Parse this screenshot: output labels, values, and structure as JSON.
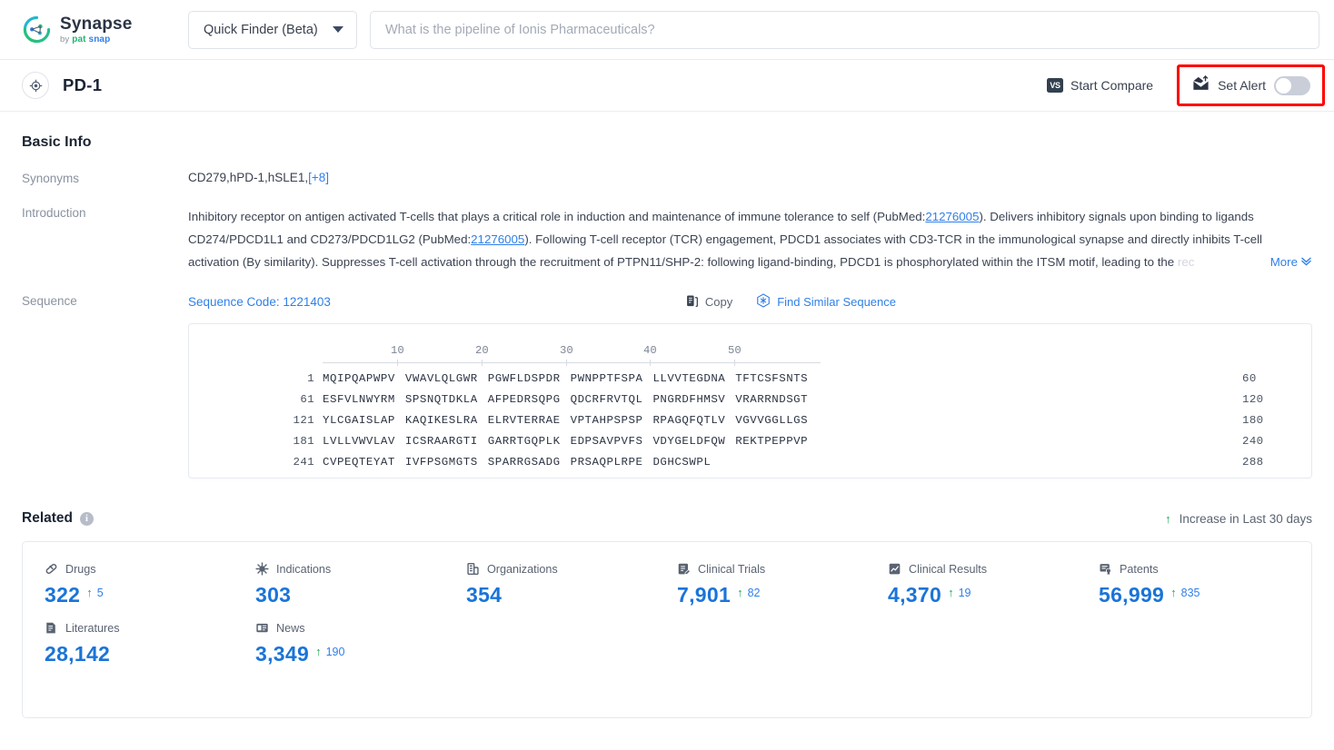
{
  "brand": {
    "name": "Synapse",
    "by": "by",
    "sub1": "pat",
    "sub2": "snap"
  },
  "topbar": {
    "finder_label": "Quick Finder (Beta)",
    "search_placeholder": "What is the pipeline of Ionis Pharmaceuticals?",
    "search_value": ""
  },
  "entity": {
    "name": "PD-1",
    "icon": "target-icon",
    "compare_label": "Start Compare",
    "compare_badge": "VS",
    "alert_label": "Set Alert",
    "alert_on": false,
    "highlight_color": "#ff0000"
  },
  "basic_info": {
    "title": "Basic Info",
    "synonyms_label": "Synonyms",
    "synonyms_value": "CD279,hPD-1,hSLE1,",
    "synonyms_more": "[+8]",
    "introduction_label": "Introduction",
    "introduction_parts": {
      "p1": "Inhibitory receptor on antigen activated T-cells that plays a critical role in induction and maintenance of immune tolerance to self (PubMed:",
      "pmid1": "21276005",
      "p2": "). Delivers inhibitory signals upon binding to ligands CD274/PDCD1L1 and CD273/PDCD1LG2 (PubMed:",
      "pmid2": "21276005",
      "p3": "). Following T-cell receptor (TCR) engagement, PDCD1 associates with CD3-TCR in the immunological synapse and directly inhibits T-cell activation (By similarity). Suppresses T-cell activation through the recruitment of PTPN11/SHP-2: following ligand-binding, PDCD1 is phosphorylated within the ITSM motif, leading to the ",
      "tail": "rec"
    },
    "more_label": "More",
    "more_chevron": "⌄"
  },
  "sequence": {
    "label": "Sequence",
    "code_label": "Sequence Code: 1221403",
    "copy_label": "Copy",
    "find_similar_label": "Find Similar Sequence",
    "ruler_ticks": [
      "10",
      "20",
      "30",
      "40",
      "50"
    ],
    "rows": [
      {
        "start": "1",
        "blocks": [
          "MQIPQAPWPV",
          "VWAVLQLGWR",
          "PGWFLDSPDR",
          "PWNPPTFSPA",
          "LLVVTEGDNA",
          "TFTCSFSNTS"
        ],
        "end": "60"
      },
      {
        "start": "61",
        "blocks": [
          "ESFVLNWYRM",
          "SPSNQTDKLA",
          "AFPEDRSQPG",
          "QDCRFRVTQL",
          "PNGRDFHMSV",
          "VRARRNDSGT"
        ],
        "end": "120"
      },
      {
        "start": "121",
        "blocks": [
          "YLCGAISLAP",
          "KAQIKESLRA",
          "ELRVTERRAE",
          "VPTAHPSPSP",
          "RPAGQFQTLV",
          "VGVVGGLLGS"
        ],
        "end": "180"
      },
      {
        "start": "181",
        "blocks": [
          "LVLLVWVLAV",
          "ICSRAARGTI",
          "GARRTGQPLK",
          "EDPSAVPVFS",
          "VDYGELDFQW",
          "REKTPEPPVP"
        ],
        "end": "240"
      },
      {
        "start": "241",
        "blocks": [
          "CVPEQTEYAT",
          "IVFPSGMGTS",
          "SPARRGSADG",
          "PRSAQPLRPE",
          "DGHCSWPL"
        ],
        "end": "288"
      }
    ]
  },
  "related": {
    "title": "Related",
    "info_glyph": "i",
    "legend_label": "Increase in Last 30 days",
    "legend_arrow": "↑",
    "stats": [
      {
        "icon": "pill-icon",
        "label": "Drugs",
        "value": "322",
        "delta": "5"
      },
      {
        "icon": "virus-icon",
        "label": "Indications",
        "value": "303",
        "delta": ""
      },
      {
        "icon": "building-icon",
        "label": "Organizations",
        "value": "354",
        "delta": ""
      },
      {
        "icon": "clipboard-pen-icon",
        "label": "Clinical Trials",
        "value": "7,901",
        "delta": "82"
      },
      {
        "icon": "chart-doc-icon",
        "label": "Clinical Results",
        "value": "4,370",
        "delta": "19"
      },
      {
        "icon": "patent-icon",
        "label": "Patents",
        "value": "56,999",
        "delta": "835"
      },
      {
        "icon": "book-icon",
        "label": "Literatures",
        "value": "28,142",
        "delta": ""
      },
      {
        "icon": "news-icon",
        "label": "News",
        "value": "3,349",
        "delta": "190"
      }
    ]
  },
  "colors": {
    "accent_blue": "#2f7fe8",
    "value_blue": "#1a74d8",
    "increase_green": "#21a95a",
    "border": "#e6e9ee"
  }
}
